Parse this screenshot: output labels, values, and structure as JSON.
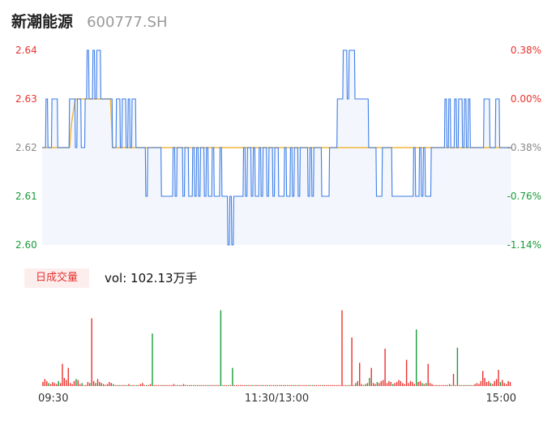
{
  "header": {
    "name": "新潮能源",
    "code": "600777.SH"
  },
  "volume_tag": "日成交量",
  "volume_text": "vol: 102.13万手",
  "colors": {
    "up": "#e8332f",
    "down": "#1a9b3c",
    "neutral": "#888888",
    "price_line": "#3d7ee8",
    "avg_line": "#f2b63c",
    "area_fill": "#f3f6fc"
  },
  "chart_data": {
    "type": "line",
    "title": "",
    "prev_close": 2.62,
    "y_left_ticks": [
      "2.64",
      "2.63",
      "2.62",
      "2.61",
      "2.60"
    ],
    "y_right_ticks": [
      "0.38%",
      "0.00%",
      "-0.38%",
      "-0.76%",
      "-1.14%"
    ],
    "ylim": [
      2.6,
      2.64
    ],
    "x_ticks": [
      "09:30",
      "11:30/13:00",
      "15:00"
    ],
    "minutes_total": 240,
    "avg_line": {
      "name": "average",
      "points": [
        [
          0,
          2.62
        ],
        [
          14,
          2.62
        ],
        [
          15,
          2.625
        ],
        [
          17,
          2.63
        ],
        [
          35,
          2.63
        ],
        [
          36,
          2.62
        ],
        [
          240,
          2.62
        ]
      ]
    },
    "price": [
      2.62,
      2.62,
      2.63,
      2.62,
      2.62,
      2.63,
      2.63,
      2.63,
      2.62,
      2.62,
      2.62,
      2.62,
      2.62,
      2.62,
      2.63,
      2.63,
      2.63,
      2.62,
      2.63,
      2.63,
      2.62,
      2.62,
      2.63,
      2.64,
      2.63,
      2.63,
      2.64,
      2.63,
      2.64,
      2.64,
      2.63,
      2.63,
      2.63,
      2.63,
      2.63,
      2.63,
      2.62,
      2.62,
      2.63,
      2.63,
      2.62,
      2.63,
      2.63,
      2.62,
      2.63,
      2.62,
      2.63,
      2.63,
      2.62,
      2.62,
      2.62,
      2.62,
      2.62,
      2.61,
      2.62,
      2.62,
      2.62,
      2.62,
      2.62,
      2.62,
      2.62,
      2.61,
      2.61,
      2.61,
      2.61,
      2.61,
      2.61,
      2.62,
      2.61,
      2.62,
      2.62,
      2.62,
      2.61,
      2.62,
      2.62,
      2.61,
      2.61,
      2.62,
      2.61,
      2.62,
      2.61,
      2.62,
      2.62,
      2.61,
      2.62,
      2.61,
      2.61,
      2.62,
      2.61,
      2.61,
      2.61,
      2.62,
      2.61,
      2.61,
      2.61,
      2.6,
      2.61,
      2.6,
      2.61,
      2.61,
      2.61,
      2.61,
      2.61,
      2.62,
      2.61,
      2.62,
      2.62,
      2.61,
      2.62,
      2.61,
      2.61,
      2.62,
      2.61,
      2.62,
      2.62,
      2.61,
      2.62,
      2.62,
      2.61,
      2.62,
      2.62,
      2.61,
      2.61,
      2.61,
      2.62,
      2.61,
      2.61,
      2.62,
      2.61,
      2.62,
      2.62,
      2.61,
      2.62,
      2.62,
      2.62,
      2.62,
      2.61,
      2.62,
      2.61,
      2.62,
      2.62,
      2.62,
      2.62,
      2.61,
      2.61,
      2.61,
      2.61,
      2.62,
      2.62,
      2.62,
      2.62,
      2.63,
      2.63,
      2.63,
      2.64,
      2.64,
      2.63,
      2.64,
      2.64,
      2.64,
      2.63,
      2.63,
      2.63,
      2.63,
      2.63,
      2.63,
      2.63,
      2.62,
      2.62,
      2.62,
      2.62,
      2.61,
      2.61,
      2.61,
      2.62,
      2.62,
      2.62,
      2.62,
      2.62,
      2.61,
      2.61,
      2.61,
      2.61,
      2.61,
      2.61,
      2.61,
      2.61,
      2.61,
      2.61,
      2.61,
      2.62,
      2.61,
      2.61,
      2.62,
      2.61,
      2.62,
      2.61,
      2.61,
      2.61,
      2.62,
      2.62,
      2.62,
      2.62,
      2.62,
      2.62,
      2.62,
      2.63,
      2.62,
      2.63,
      2.62,
      2.62,
      2.63,
      2.62,
      2.63,
      2.63,
      2.62,
      2.63,
      2.62,
      2.63,
      2.62,
      2.62,
      2.62,
      2.62,
      2.62,
      2.62,
      2.62,
      2.63,
      2.63,
      2.63,
      2.62,
      2.62,
      2.62,
      2.63,
      2.63,
      2.62,
      2.62,
      2.62,
      2.62,
      2.62,
      2.62
    ],
    "volume_max_wan": 8.5,
    "volume_wan": [
      0.4,
      0.7,
      0.5,
      0.3,
      0.2,
      0.4,
      0.3,
      0.2,
      0.5,
      0.3,
      0.9,
      0.8,
      0.6,
      0.2,
      0.3,
      0.2,
      0.5,
      0.7,
      0.6,
      0.2,
      0.3,
      0.1,
      0.1,
      0.4,
      0.3,
      0.2,
      0.5,
      0.3,
      0.7,
      0.4,
      0.3,
      0.2,
      0.1,
      0.2,
      0.4,
      0.3,
      0.2,
      0.1,
      0.1,
      0.1,
      0.1,
      0.1,
      0.1,
      0.1,
      0.2,
      0.1,
      0.1,
      0.1,
      0.1,
      0.1,
      0.2,
      0.3,
      0.1,
      0.1,
      0.1,
      0.2,
      0.1,
      0.1,
      0.1,
      0.1,
      0.1,
      0.1,
      0.1,
      0.1,
      0.1,
      0.1,
      0.1,
      0.2,
      0.1,
      0.1,
      0.1,
      0.1,
      0.2,
      0.1,
      0.1,
      0.1,
      0.1,
      0.1,
      0.1,
      0.1,
      0.1,
      0.1,
      0.1,
      0.1,
      0.1,
      0.1,
      0.1,
      0.1,
      0.1,
      0.1,
      0.1,
      0.1,
      0.1,
      0.1,
      0.1,
      0.1,
      0.1,
      0.1,
      0.1,
      0.1,
      0.1,
      0.1,
      0.1,
      0.1,
      0.1,
      0.1,
      0.1,
      0.1,
      0.1,
      0.1,
      0.1,
      0.1,
      0.1,
      0.1,
      0.1,
      0.1,
      0.1,
      0.1,
      0.1,
      0.1,
      0.1,
      0.1,
      0.1,
      0.1,
      0.1,
      0.1,
      0.1,
      0.1,
      0.1,
      0.1,
      0.1,
      0.1,
      0.1,
      0.1,
      0.1,
      0.1,
      0.1,
      0.1,
      0.1,
      0.1,
      0.1,
      0.1,
      0.1,
      0.1,
      0.1,
      0.1,
      0.1,
      0.1,
      0.1,
      0.1,
      0.1,
      0.1,
      0.1,
      0.1,
      0.1,
      0.1,
      0.1,
      0.1,
      0.1,
      0.1,
      0.3,
      0.5,
      0.3,
      0.2,
      0.1,
      0.2,
      0.3,
      0.8,
      0.6,
      0.3,
      0.2,
      0.4,
      0.3,
      0.5,
      0.6,
      0.2,
      0.3,
      0.5,
      0.4,
      0.2,
      0.3,
      0.4,
      0.6,
      0.5,
      0.3,
      0.2,
      0.4,
      0.3,
      0.5,
      0.4,
      0.2,
      0.3,
      0.4,
      0.5,
      0.3,
      0.2,
      0.3,
      0.4,
      0.3,
      0.2,
      0.1,
      0.1,
      0.1,
      0.1,
      0.1,
      0.1,
      0.1,
      0.1,
      0.2,
      0.1,
      0.1,
      0.1,
      0.2,
      0.1,
      0.1,
      0.1,
      0.1,
      0.1,
      0.1,
      0.1,
      0.1,
      0.2,
      0.3,
      0.2,
      0.5,
      0.6,
      0.8,
      0.4,
      0.5,
      0.3,
      0.2,
      0.5,
      0.7,
      0.9,
      0.4,
      0.6,
      0.3,
      0.2,
      0.5,
      0.4
    ],
    "volume_spikes": [
      [
        10,
        2.2
      ],
      [
        13,
        1.8
      ],
      [
        25,
        6.7
      ],
      [
        56,
        5.2
      ],
      [
        91,
        7.5
      ],
      [
        97,
        1.8
      ],
      [
        153,
        7.5
      ],
      [
        158,
        4.8
      ],
      [
        162,
        2.3
      ],
      [
        168,
        1.8
      ],
      [
        175,
        3.7
      ],
      [
        186,
        2.6
      ],
      [
        191,
        5.6
      ],
      [
        197,
        2.2
      ],
      [
        210,
        1.2
      ],
      [
        212,
        3.8
      ],
      [
        225,
        1.5
      ],
      [
        233,
        1.6
      ]
    ],
    "volume_down_bars": [
      56,
      91,
      160,
      165
    ]
  }
}
